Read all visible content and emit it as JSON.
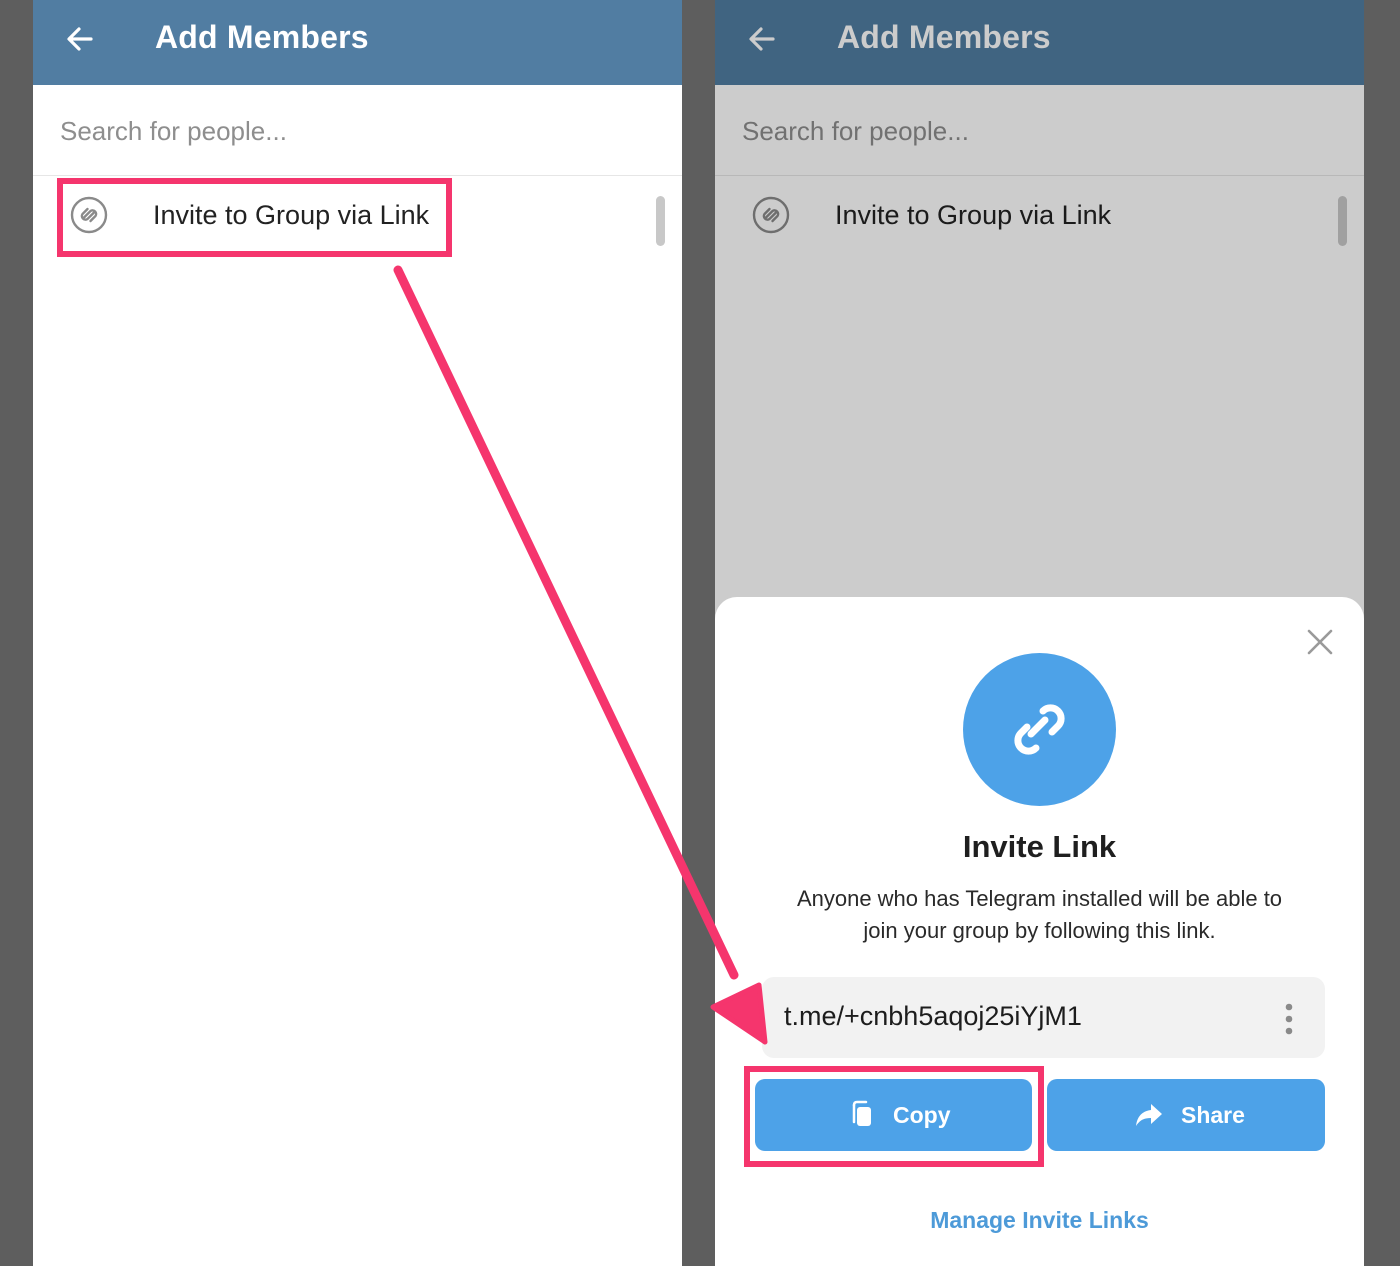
{
  "left_screen": {
    "header": {
      "title": "Add Members",
      "back_icon": "arrow-left-icon"
    },
    "search": {
      "placeholder": "Search for people..."
    },
    "list": [
      {
        "label": "Invite to Group via Link",
        "icon": "link-icon"
      }
    ]
  },
  "right_screen": {
    "header": {
      "title": "Add Members",
      "back_icon": "arrow-left-icon"
    },
    "search": {
      "placeholder": "Search for people..."
    },
    "list": [
      {
        "label": "Invite to Group via Link",
        "icon": "link-icon"
      }
    ],
    "sheet": {
      "title": "Invite Link",
      "description_line1": "Anyone who has Telegram installed will be able to",
      "description_line2": "join your group by following this link.",
      "link_value": "t.me/+cnbh5aqoj25iYjM1",
      "copy_label": "Copy",
      "share_label": "Share",
      "manage_label": "Manage Invite Links"
    }
  },
  "colors": {
    "header": "#517da2",
    "accent": "#4da2e8",
    "link_text": "#4d9ad8",
    "highlight": "#f5356d",
    "background": "#5e5e5e"
  }
}
